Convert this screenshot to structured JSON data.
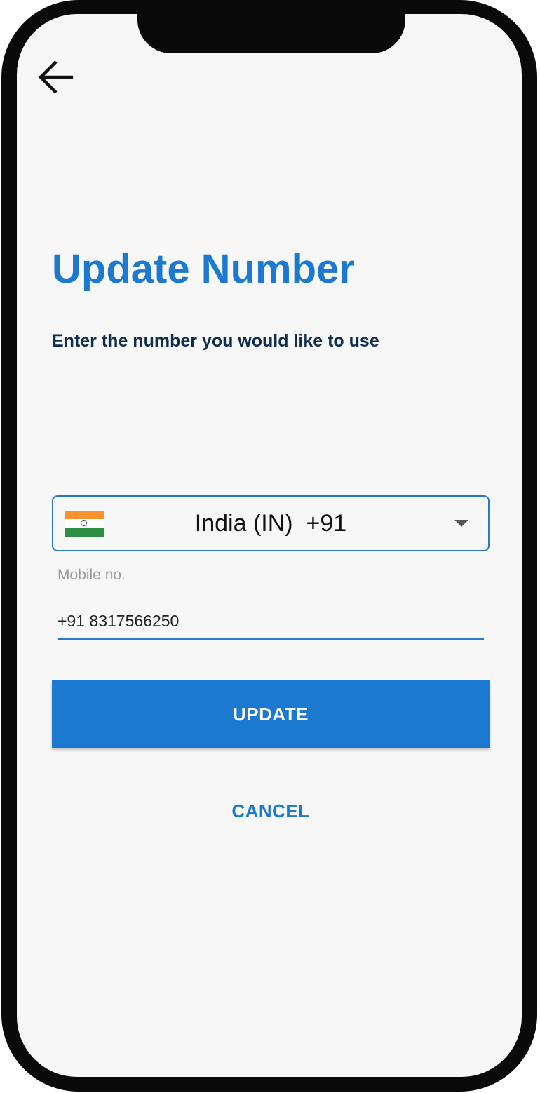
{
  "header": {
    "back_icon": "arrow-left-icon"
  },
  "page": {
    "title": "Update Number",
    "subtitle": "Enter the number you would like to use"
  },
  "country_select": {
    "flag_icon": "india-flag-icon",
    "selected_label": "India (IN)  +91",
    "arrow_icon": "dropdown-arrow-icon"
  },
  "mobile": {
    "label": "Mobile no.",
    "value": "+91 8317566250"
  },
  "actions": {
    "update_label": "UPDATE",
    "cancel_label": "CANCEL"
  },
  "colors": {
    "accent": "#1b7ad0",
    "title_dark": "#0f2d4d",
    "background": "#f7f7f7",
    "frame": "#0a0a0a"
  }
}
